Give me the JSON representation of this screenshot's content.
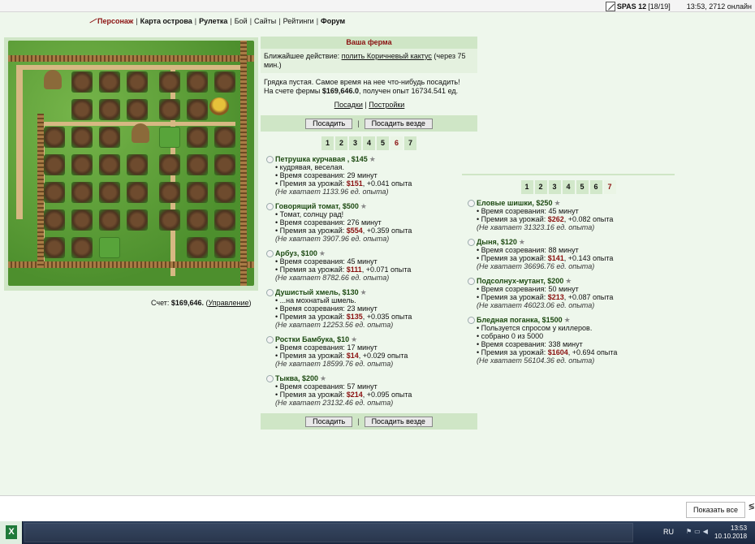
{
  "topbar": {
    "username": "SPAS 12",
    "hp": "[18/19]",
    "clock_online": "13:53, 2712 онлайн"
  },
  "nav": [
    {
      "label": "Персонаж",
      "bold": true,
      "active": true
    },
    {
      "label": "Карта острова",
      "bold": true
    },
    {
      "label": "Рулетка",
      "bold": true
    },
    {
      "label": "Бой",
      "bold": false
    },
    {
      "label": "Сайты",
      "bold": false
    },
    {
      "label": "Рейтинги",
      "bold": false
    },
    {
      "label": "Форум",
      "bold": true
    }
  ],
  "score": {
    "label": "Счет: ",
    "value": "$169,646.",
    "link": "Управление"
  },
  "farm_panel": {
    "title": "Ваша ферма",
    "next_action_label": "Ближайшее действие: ",
    "next_action_link": "полить Коричневый кактус",
    "next_action_time": " (через 75 мин.)",
    "empty_bed": "Грядка пустая. Самое время на нее что-нибудь посадить!",
    "account_prefix": "На счете фермы ",
    "account_value": "$169,646.0",
    "account_suffix": ", получен опыт 16734.541 ед.",
    "link_plantings": "Посадки",
    "link_buildings": "Постройки",
    "plant_button": "Посадить",
    "plant_everywhere_button": "Посадить везде"
  },
  "tabs": [
    "1",
    "2",
    "3",
    "4",
    "5",
    "6",
    "7"
  ],
  "left_active_tab": "6",
  "right_active_tab": "7",
  "plants_left": [
    {
      "name": "Петрушка курчавая ",
      "price": "$145",
      "desc": "кудрявая, веселая.",
      "time": "29 минут",
      "bonus": "$151",
      "exp": ", +0.041 опыта",
      "miss": "(Не хватает 1133.96 ед. опыта)"
    },
    {
      "name": "Говорящий томат",
      "price": "$500",
      "desc": "Томат, солнцу рад!",
      "time": "276 минут",
      "bonus": "$554",
      "exp": ", +0.359 опыта",
      "miss": "(Не хватает 3907.96 ед. опыта)"
    },
    {
      "name": "Арбуз",
      "price": "$100",
      "desc": "",
      "time": "45 минут",
      "bonus": "$111",
      "exp": ", +0.071 опыта",
      "miss": "(Не хватает 8782.66 ед. опыта)"
    },
    {
      "name": "Душистый хмель",
      "price": "$130",
      "desc": "...на мохнатый шмель.",
      "time": "23 минут",
      "bonus": "$135",
      "exp": ", +0.035 опыта",
      "miss": "(Не хватает 12253.56 ед. опыта)"
    },
    {
      "name": "Ростки Бамбука",
      "price": "$10",
      "desc": "",
      "time": "17 минут",
      "bonus": "$14",
      "exp": ", +0.029 опыта",
      "miss": "(Не хватает 18599.76 ед. опыта)"
    },
    {
      "name": "Тыква",
      "price": "$200",
      "desc": "",
      "time": "57 минут",
      "bonus": "$214",
      "exp": ", +0.095 опыта",
      "miss": "(Не хватает 23132.46 ед. опыта)"
    }
  ],
  "plants_right": [
    {
      "name": "Еловые шишки",
      "price": "$250",
      "desc": "",
      "extra": "",
      "time": "45 минут",
      "bonus": "$262",
      "exp": ", +0.082 опыта",
      "miss": "(Не хватает 31323.16 ед. опыта)"
    },
    {
      "name": "Дыня",
      "price": "$120",
      "desc": "",
      "extra": "",
      "time": "88 минут",
      "bonus": "$141",
      "exp": ", +0.143 опыта",
      "miss": "(Не хватает 36696.76 ед. опыта)"
    },
    {
      "name": "Подсолнух-мутант",
      "price": "$200",
      "desc": "",
      "extra": "",
      "time": "50 минут",
      "bonus": "$213",
      "exp": ", +0.087 опыта",
      "miss": "(Не хватает 46023.06 ед. опыта)"
    },
    {
      "name": "Бледная поганка",
      "price": "$1500",
      "desc": "Пользуется спросом у киллеров.",
      "extra": "собрано 0 из 5000",
      "time": "338 минут",
      "bonus": "$1604",
      "exp": ", +0.694 опыта",
      "miss": "(Не хватает 56104.36 ед. опыта)"
    }
  ],
  "labels": {
    "bullet": "• ",
    "time_label": "Время созревания: ",
    "bonus_label": "Премия за урожай: ",
    "sep": "|",
    "comma": ", ",
    "star": "★"
  },
  "findbar": {
    "show_all": "Показать все",
    "edge": "≶"
  },
  "taskbar": {
    "start_letter": "X",
    "lang": "RU",
    "time": "13:53",
    "date": "10.10.2018"
  }
}
